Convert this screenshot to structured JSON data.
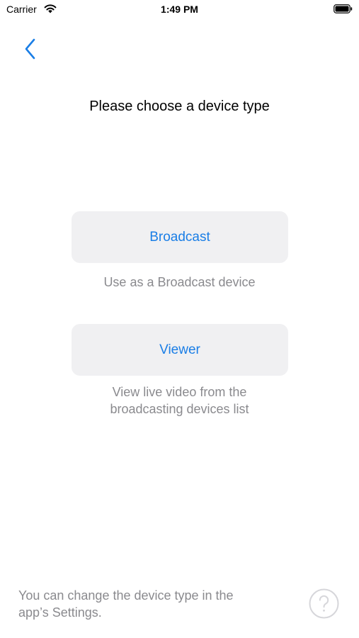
{
  "status_bar": {
    "carrier": "Carrier",
    "time": "1:49 PM"
  },
  "nav": {
    "back_icon": "chevron-left-icon"
  },
  "title": "Please choose a device type",
  "options": [
    {
      "label": "Broadcast",
      "caption_lines": [
        "Use as a Broadcast device"
      ]
    },
    {
      "label": "Viewer",
      "caption_lines": [
        "View live video from the",
        "broadcasting devices list"
      ]
    }
  ],
  "footer": {
    "note_lines": [
      "You can change the device type in the",
      "app’s Settings."
    ],
    "help_icon": "question-mark-circle-icon"
  },
  "colors": {
    "accent": "#1a7ee6",
    "button_background": "#f0f0f2",
    "secondary_text": "#8a8a8e"
  }
}
